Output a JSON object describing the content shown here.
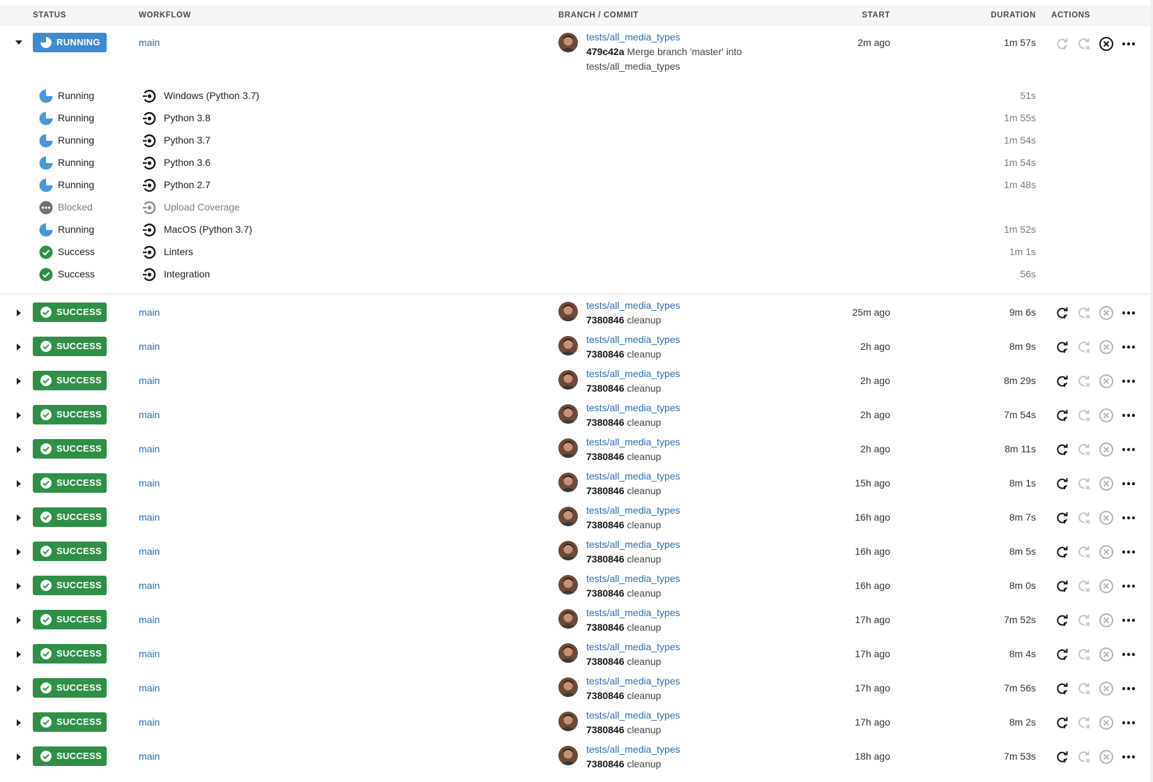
{
  "columns": {
    "status": "STATUS",
    "workflow": "WORKFLOW",
    "branch_commit": "BRANCH / COMMIT",
    "start": "START",
    "duration": "DURATION",
    "actions": "ACTIONS"
  },
  "running_pipeline": {
    "status": "RUNNING",
    "workflow": "main",
    "branch": "tests/all_media_types",
    "commit_sha": "479c42a",
    "commit_message": "Merge branch 'master' into tests/all_media_types",
    "start": "2m ago",
    "duration": "1m 57s",
    "jobs": [
      {
        "status": "Running",
        "name": "Windows (Python 3.7)",
        "duration": "51s",
        "state": "running",
        "icon": "running-pie-icon"
      },
      {
        "status": "Running",
        "name": "Python 3.8",
        "duration": "1m 55s",
        "state": "running",
        "icon": "running-pie-icon"
      },
      {
        "status": "Running",
        "name": "Python 3.7",
        "duration": "1m 54s",
        "state": "running",
        "icon": "running-pie-icon"
      },
      {
        "status": "Running",
        "name": "Python 3.6",
        "duration": "1m 54s",
        "state": "running",
        "icon": "running-pie-icon"
      },
      {
        "status": "Running",
        "name": "Python 2.7",
        "duration": "1m 48s",
        "state": "running",
        "icon": "running-pie-icon"
      },
      {
        "status": "Blocked",
        "name": "Upload Coverage",
        "duration": "",
        "state": "blocked",
        "icon": "blocked-dots-icon"
      },
      {
        "status": "Running",
        "name": "MacOS (Python 3.7)",
        "duration": "1m 52s",
        "state": "running",
        "icon": "running-pie-icon"
      },
      {
        "status": "Success",
        "name": "Linters",
        "duration": "1m 1s",
        "state": "success",
        "icon": "success-check-icon"
      },
      {
        "status": "Success",
        "name": "Integration",
        "duration": "56s",
        "state": "success",
        "icon": "success-check-icon"
      }
    ]
  },
  "pipelines": [
    {
      "status": "SUCCESS",
      "workflow": "main",
      "branch": "tests/all_media_types",
      "commit_sha": "7380846",
      "commit_message": "cleanup",
      "start": "25m ago",
      "duration": "9m 6s"
    },
    {
      "status": "SUCCESS",
      "workflow": "main",
      "branch": "tests/all_media_types",
      "commit_sha": "7380846",
      "commit_message": "cleanup",
      "start": "2h ago",
      "duration": "8m 9s"
    },
    {
      "status": "SUCCESS",
      "workflow": "main",
      "branch": "tests/all_media_types",
      "commit_sha": "7380846",
      "commit_message": "cleanup",
      "start": "2h ago",
      "duration": "8m 29s"
    },
    {
      "status": "SUCCESS",
      "workflow": "main",
      "branch": "tests/all_media_types",
      "commit_sha": "7380846",
      "commit_message": "cleanup",
      "start": "2h ago",
      "duration": "7m 54s"
    },
    {
      "status": "SUCCESS",
      "workflow": "main",
      "branch": "tests/all_media_types",
      "commit_sha": "7380846",
      "commit_message": "cleanup",
      "start": "2h ago",
      "duration": "8m 11s"
    },
    {
      "status": "SUCCESS",
      "workflow": "main",
      "branch": "tests/all_media_types",
      "commit_sha": "7380846",
      "commit_message": "cleanup",
      "start": "15h ago",
      "duration": "8m 1s"
    },
    {
      "status": "SUCCESS",
      "workflow": "main",
      "branch": "tests/all_media_types",
      "commit_sha": "7380846",
      "commit_message": "cleanup",
      "start": "16h ago",
      "duration": "8m 7s"
    },
    {
      "status": "SUCCESS",
      "workflow": "main",
      "branch": "tests/all_media_types",
      "commit_sha": "7380846",
      "commit_message": "cleanup",
      "start": "16h ago",
      "duration": "8m 5s"
    },
    {
      "status": "SUCCESS",
      "workflow": "main",
      "branch": "tests/all_media_types",
      "commit_sha": "7380846",
      "commit_message": "cleanup",
      "start": "16h ago",
      "duration": "8m 0s"
    },
    {
      "status": "SUCCESS",
      "workflow": "main",
      "branch": "tests/all_media_types",
      "commit_sha": "7380846",
      "commit_message": "cleanup",
      "start": "17h ago",
      "duration": "7m 52s"
    },
    {
      "status": "SUCCESS",
      "workflow": "main",
      "branch": "tests/all_media_types",
      "commit_sha": "7380846",
      "commit_message": "cleanup",
      "start": "17h ago",
      "duration": "8m 4s"
    },
    {
      "status": "SUCCESS",
      "workflow": "main",
      "branch": "tests/all_media_types",
      "commit_sha": "7380846",
      "commit_message": "cleanup",
      "start": "17h ago",
      "duration": "7m 56s"
    },
    {
      "status": "SUCCESS",
      "workflow": "main",
      "branch": "tests/all_media_types",
      "commit_sha": "7380846",
      "commit_message": "cleanup",
      "start": "17h ago",
      "duration": "8m 2s"
    },
    {
      "status": "SUCCESS",
      "workflow": "main",
      "branch": "tests/all_media_types",
      "commit_sha": "7380846",
      "commit_message": "cleanup",
      "start": "18h ago",
      "duration": "7m 53s"
    }
  ],
  "colors": {
    "running": "#3f89cf",
    "success": "#2f8f47",
    "blocked": "#707070",
    "link": "#2b6cb0"
  },
  "icons": {
    "rerun": "rerun-icon",
    "rerun_failed": "rerun-failed-icon",
    "cancel": "cancel-icon",
    "more": "more-options-icon",
    "workflow": "workflow-job-icon"
  }
}
